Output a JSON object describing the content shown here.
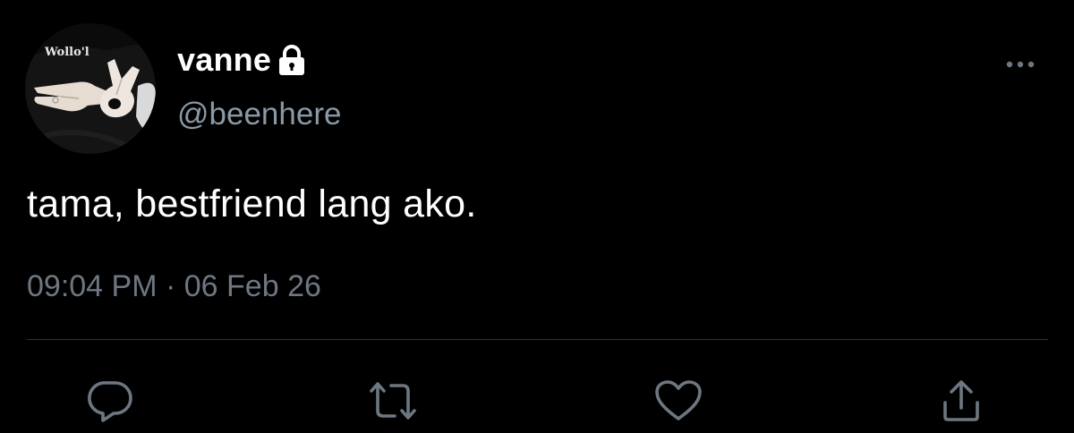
{
  "tweet": {
    "display_name": "vanne",
    "handle": "@beenhere",
    "text": "tama, bestfriend lang ako.",
    "time": "09:04 PM",
    "separator": "·",
    "date": "06 Feb 26",
    "avatar_text": "Wollo'l",
    "verified_lock": true
  },
  "icons": {
    "lock": "lock-icon",
    "more": "more-options-icon",
    "reply": "reply-icon",
    "retweet": "retweet-icon",
    "like": "heart-icon",
    "share": "share-icon"
  },
  "colors": {
    "background": "#000000",
    "primary_text": "#ffffff",
    "secondary_text": "#8b98a5",
    "meta_text": "#6e7781",
    "divider": "#2f3336",
    "icon": "#6e7781"
  }
}
